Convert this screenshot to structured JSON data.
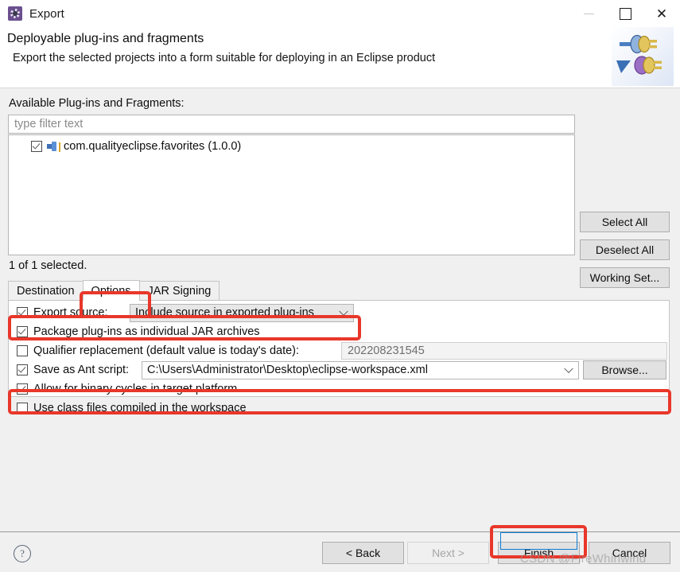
{
  "window": {
    "title": "Export",
    "icon": "eclipse-export-icon",
    "controls": {
      "minimize": "minimize-icon",
      "maximize": "maximize-icon",
      "close": "close-icon"
    }
  },
  "banner": {
    "title": "Deployable plug-ins and fragments",
    "subtitle": "Export the selected projects into a form suitable for deploying in an Eclipse product",
    "art": "plugin-export-banner-icon"
  },
  "main": {
    "available_label": "Available Plug-ins and Fragments:",
    "filter_placeholder": "type filter text",
    "filter_value": "",
    "tree": {
      "items": [
        {
          "label": "com.qualityeclipse.favorites (1.0.0)",
          "checked": true,
          "icon": "plugin-icon"
        }
      ]
    },
    "selection_status": "1 of 1 selected.",
    "side_buttons": [
      {
        "label": "Select All"
      },
      {
        "label": "Deselect All"
      },
      {
        "label": "Working Set..."
      }
    ]
  },
  "tabs": [
    {
      "label": "Destination",
      "active": false
    },
    {
      "label": "Options",
      "active": true
    },
    {
      "label": "JAR Signing",
      "active": false
    }
  ],
  "options": {
    "export_source": {
      "label": "Export source:",
      "checked": true,
      "combo_value": "Include source in exported plug-ins",
      "combo_icon": "chevron-down-icon"
    },
    "package_jar": {
      "label": "Package plug-ins as individual JAR archives",
      "checked": true
    },
    "qualifier": {
      "label": "Qualifier replacement (default value is today's date):",
      "checked": false,
      "value": "202208231545"
    },
    "ant_script": {
      "label": "Save as Ant script:",
      "checked": true,
      "path": "C:\\Users\\Administrator\\Desktop\\eclipse-workspace.xml",
      "combo_icon": "chevron-down-icon",
      "browse_label": "Browse..."
    },
    "binary_cycles": {
      "label": "Allow for binary cycles in target platform",
      "checked": true
    },
    "class_files": {
      "label": "Use class files compiled in the workspace",
      "checked": false
    }
  },
  "footer": {
    "help": "?",
    "back_label": "< Back",
    "next_label": "Next >",
    "finish_label": "Finish",
    "cancel_label": "Cancel"
  },
  "watermark": "CSDN @FireWhirlwind",
  "colors": {
    "highlight": "#e8372a",
    "focus_border": "#0b7bd4",
    "dialog_bg": "#f0f0f0"
  }
}
